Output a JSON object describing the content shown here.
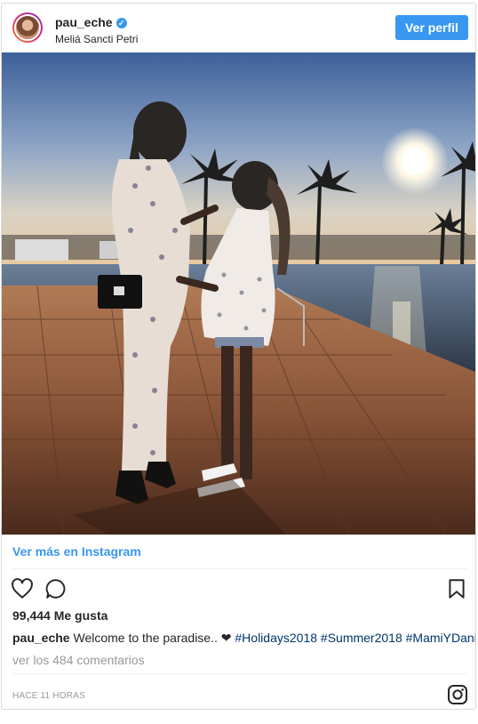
{
  "post": {
    "username": "pau_eche",
    "location": "Meliá Sancti Petri",
    "view_profile_label": "Ver perfil",
    "view_more_label": "Ver más en Instagram",
    "likes_text": "99,444 Me gusta",
    "caption": {
      "user": "pau_eche",
      "text": "Welcome to the paradise..",
      "emoji": "❤",
      "tags": [
        "#Holidays2018",
        "#Summer2018",
        "#MamiYDani"
      ]
    },
    "comments_text": "ver los 484 comentarios",
    "time_text": "HACE 11 HORAS"
  },
  "icons": {
    "verified": "verified-badge-icon",
    "like": "heart-icon",
    "comment": "comment-bubble-icon",
    "save": "bookmark-icon",
    "instagram": "instagram-logo-icon"
  },
  "colors": {
    "accent": "#3897f0",
    "text": "#262626",
    "muted": "#999999",
    "hashtag": "#003569",
    "border": "#dbdbdb"
  }
}
